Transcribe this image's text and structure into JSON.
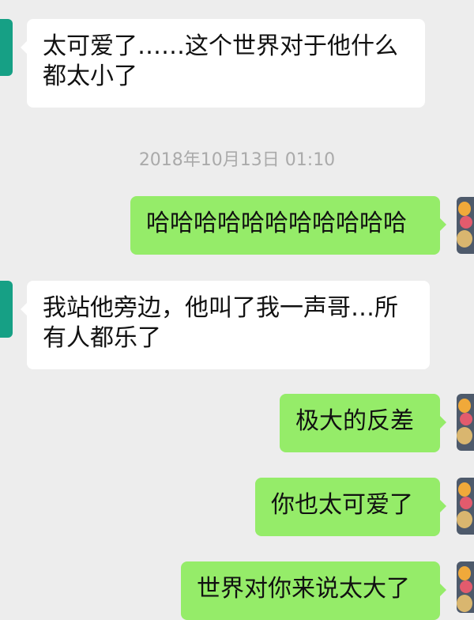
{
  "timestamp": "2018年10月13日 01:10",
  "messages": [
    {
      "side": "left",
      "text": "太可爱了……这个世界对于他什么都太小了"
    },
    {
      "side": "right",
      "text": "哈哈哈哈哈哈哈哈哈哈哈"
    },
    {
      "side": "left",
      "text": "我站他旁边，他叫了我一声哥…所有人都乐了"
    },
    {
      "side": "right",
      "text": "极大的反差"
    },
    {
      "side": "right",
      "text": "你也太可爱了"
    },
    {
      "side": "right",
      "text": "世界对你来说太大了"
    }
  ],
  "colors": {
    "background": "#ededed",
    "incoming_bubble": "#ffffff",
    "outgoing_bubble": "#95ec69",
    "timestamp_text": "#aaaaaa"
  },
  "icons": {
    "contact_avatar": "contact-avatar-icon",
    "user_avatar": "user-avatar-icon"
  }
}
